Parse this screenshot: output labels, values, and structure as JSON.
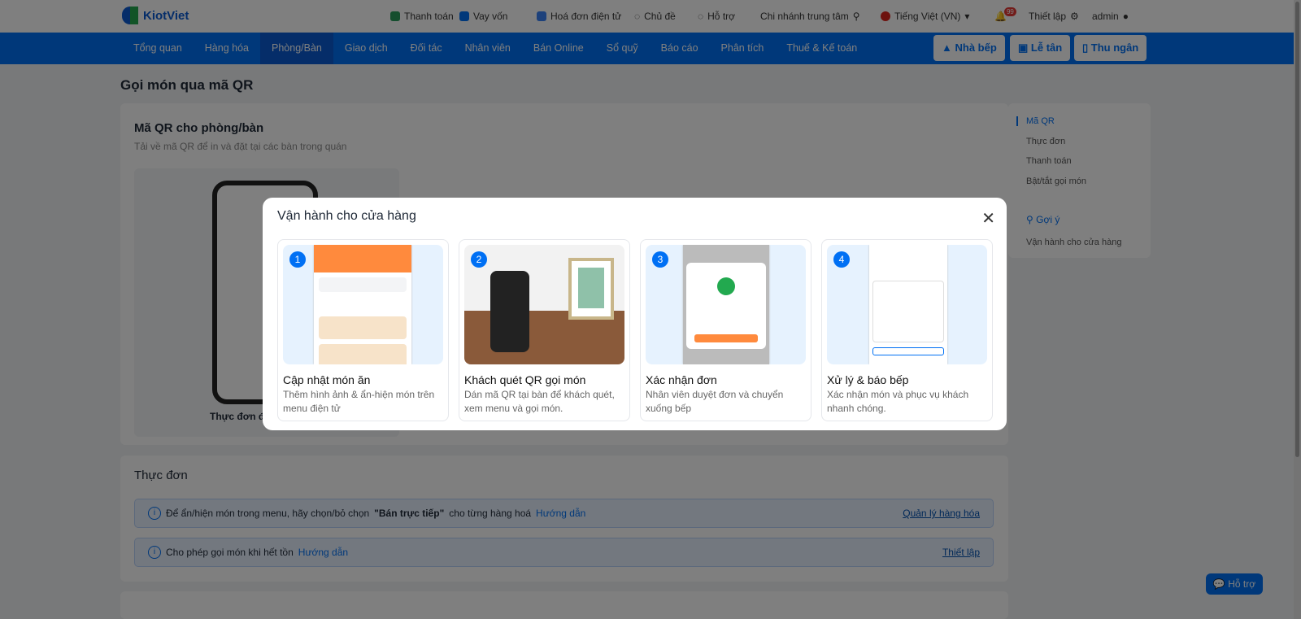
{
  "header": {
    "logo": "KiotViet",
    "links": [
      "Thanh toán",
      "Vay vốn",
      "Hoá đơn điện tử",
      "Chủ đề",
      "Hỗ trợ"
    ],
    "branch": "Chi nhánh trung tâm",
    "language": "Tiếng Việt (VN)",
    "notif_count": "99",
    "settings": "Thiết lập",
    "user": "admin"
  },
  "nav": {
    "items": [
      "Tổng quan",
      "Hàng hóa",
      "Phòng/Bàn",
      "Giao dịch",
      "Đối tác",
      "Nhân viên",
      "Bán Online",
      "Sổ quỹ",
      "Báo cáo",
      "Phân tích",
      "Thuế & Kế toán"
    ],
    "buttons": [
      "Nhà bếp",
      "Lễ tân",
      "Thu ngân"
    ]
  },
  "page": {
    "title": "Gọi món qua mã QR",
    "qr_title": "Mã QR cho phòng/bàn",
    "qr_sub": "Tải về mã QR để in và đặt tại các bàn trong quán",
    "qr_caption": "Thực đơn đi",
    "menu_title": "Thực đơn",
    "info1": {
      "pre": "Để ẩn/hiện món trong menu, hãy chọn/bỏ chọn ",
      "bold": "\"Bán trực tiếp\"",
      "post": " cho từng hàng hoá ",
      "link": "Hướng dẫn",
      "action": "Quản lý hàng hóa"
    },
    "info2": {
      "pre": "Cho phép gọi món khi hết tồn ",
      "link": "Hướng dẫn",
      "action": "Thiết lập"
    }
  },
  "side": {
    "items": [
      "Mã QR",
      "Thực đơn",
      "Thanh toán",
      "Bật/tắt gọi món"
    ],
    "hint_title": "Gợi ý",
    "hint_item": "Vận hành cho cửa hàng"
  },
  "modal": {
    "title": "Vận hành cho cửa hàng",
    "steps": [
      {
        "num": "1",
        "title": "Cập nhật món ăn",
        "desc": "Thêm hình ảnh & ẩn-hiện món trên menu điện tử"
      },
      {
        "num": "2",
        "title": "Khách quét QR gọi món",
        "desc": "Dán mã QR tại bàn để khách quét, xem menu và gọi món."
      },
      {
        "num": "3",
        "title": "Xác nhận đơn",
        "desc": "Nhân viên duyệt đơn và chuyển xuống bếp"
      },
      {
        "num": "4",
        "title": "Xử lý & báo bếp",
        "desc": "Xác nhận món và phục vụ khách nhanh chóng."
      }
    ]
  },
  "help": "Hỗ trợ"
}
